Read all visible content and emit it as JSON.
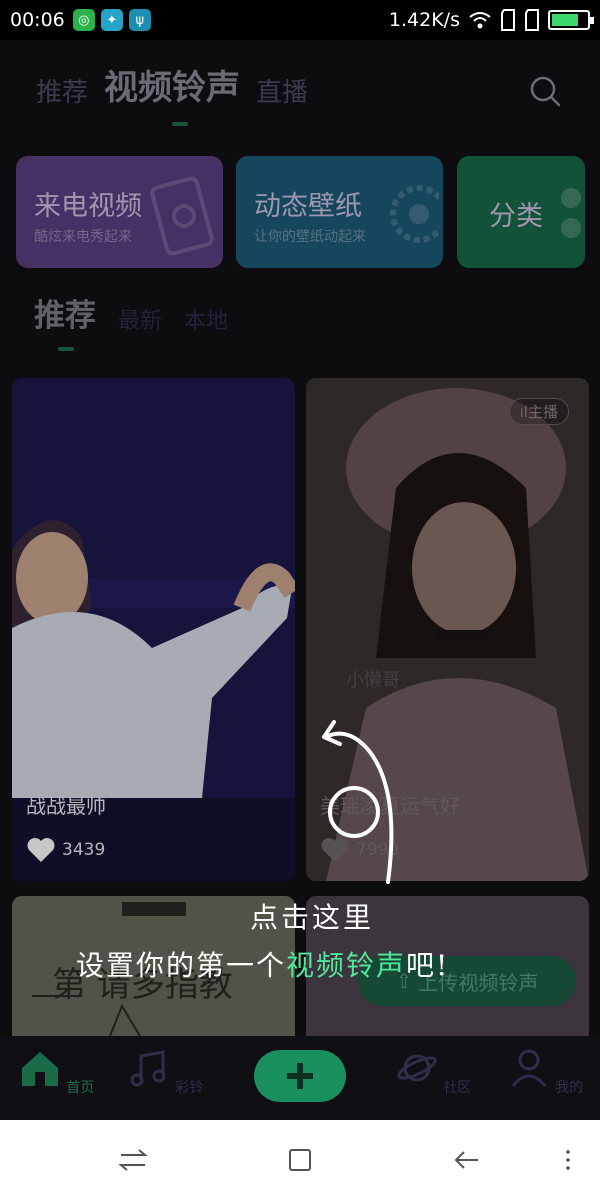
{
  "status_bar": {
    "time": "00:06",
    "net_speed": "1.42K/s",
    "icons": [
      "wechat-icon",
      "app-icon",
      "usb-icon",
      "wifi-icon",
      "sim-icon",
      "sim-icon",
      "battery-icon"
    ],
    "battery_level": 0.7
  },
  "top_tabs": [
    {
      "label": "推荐",
      "active": false
    },
    {
      "label": "视频铃声",
      "active": true
    },
    {
      "label": "直播",
      "active": false
    }
  ],
  "categories": [
    {
      "title": "来电视频",
      "subtitle": "酷炫来电秀起来"
    },
    {
      "title": "动态壁纸",
      "subtitle": "让你的壁纸动起来"
    },
    {
      "title": "分类",
      "subtitle": ""
    }
  ],
  "sub_tabs": [
    {
      "label": "推荐",
      "active": true
    },
    {
      "label": "最新",
      "active": false
    },
    {
      "label": "本地",
      "active": false
    }
  ],
  "videos": [
    {
      "caption": "战战最帅",
      "likes": "3439"
    },
    {
      "caption": "美瑶凌夏运气好",
      "likes": "7999",
      "badge": "主播",
      "watermark": "小懒哥"
    },
    {
      "caption": "",
      "likes": ""
    },
    {
      "caption": "",
      "likes": "",
      "upload_label": "上传视频铃声"
    }
  ],
  "hint": {
    "line1": "点击这里",
    "line2_pre": "设置你的第一个",
    "line2_highlight": "视频铃声",
    "line2_post": "吧!"
  },
  "bottom_nav": [
    {
      "label": "首页",
      "active": true
    },
    {
      "label": "彩铃",
      "active": false
    },
    {
      "label": "社区",
      "active": false
    },
    {
      "label": "我的",
      "active": false
    }
  ],
  "colors": {
    "accent": "#1a8f60",
    "highlight": "#4fe79a",
    "background": "#111114"
  }
}
